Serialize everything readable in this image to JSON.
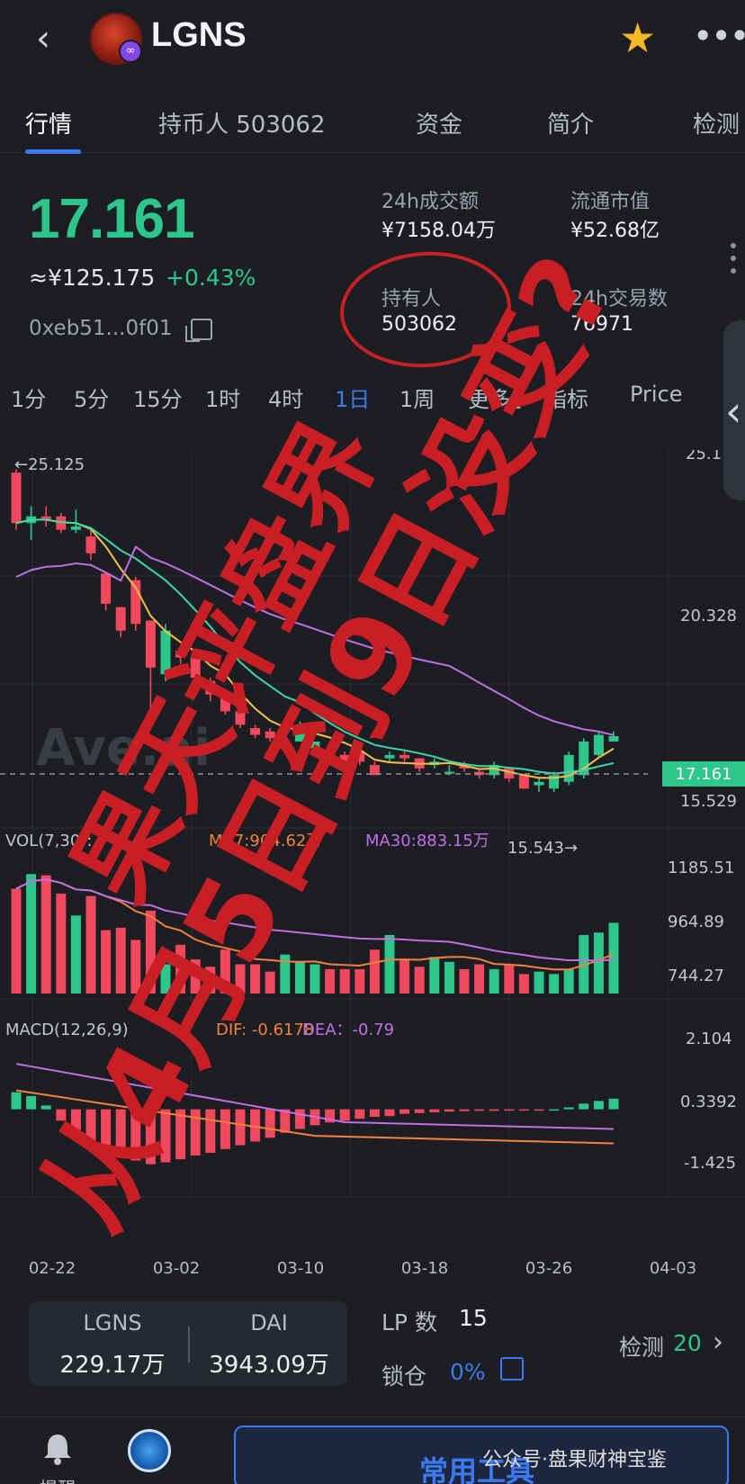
{
  "header": {
    "back_glyph": "‹",
    "title": "LGNS",
    "star_glyph": "★",
    "more_glyph": "•••"
  },
  "tabs": [
    {
      "label": "行情",
      "active": true
    },
    {
      "label": "持币人 503062",
      "active": false
    },
    {
      "label": "资金",
      "active": false
    },
    {
      "label": "简介",
      "active": false
    },
    {
      "label": "检测",
      "active": false
    }
  ],
  "price": {
    "value": "17.161",
    "fiat": "≈¥125.175",
    "change": "+0.43%",
    "address": "0xeb51...0f01"
  },
  "stats": {
    "volume_label": "24h成交额",
    "volume_value": "¥7158.04万",
    "mcap_label": "流通市值",
    "mcap_value": "¥52.68亿",
    "holders_label": "持有人",
    "holders_value": "503062",
    "tx_label": "24h交易数",
    "tx_value": "76971"
  },
  "intervals": [
    "1分",
    "5分",
    "15分",
    "1时",
    "4时",
    "1日",
    "1周",
    "更多",
    "指标",
    "Price"
  ],
  "active_interval": "1日",
  "chart_labels": {
    "high_marker": "←25.125",
    "low_marker": "15.543→",
    "price_tag": "17.161",
    "price_axis": [
      "25.1",
      "20.328",
      "15.529"
    ],
    "vol_title": "VOL(7,30):",
    "vol_ma7": "MA7:904.62万",
    "vol_ma30": "MA30:883.15万",
    "vol_axis": [
      "1185.51",
      "964.89",
      "744.27"
    ],
    "macd_title": "MACD(12,26,9)",
    "macd_dif": "DIF: -0.6178",
    "macd_dea": "DEA：-0.79",
    "macd_axis": [
      "2.104",
      "0.3392",
      "-1.425"
    ],
    "dates": [
      "02-22",
      "03-02",
      "03-10",
      "03-18",
      "03-26",
      "04-03"
    ],
    "watermark": "Ave.ai"
  },
  "chart_data": {
    "type": "candlestick",
    "x": [
      "02-21",
      "02-22",
      "02-23",
      "02-24",
      "02-25",
      "02-26",
      "02-27",
      "02-28",
      "03-01",
      "03-02",
      "03-03",
      "03-04",
      "03-05",
      "03-06",
      "03-07",
      "03-08",
      "03-09",
      "03-10",
      "03-11",
      "03-12",
      "03-13",
      "03-14",
      "03-15",
      "03-16",
      "03-17",
      "03-18",
      "03-19",
      "03-20",
      "03-21",
      "03-22",
      "03-23",
      "03-24",
      "03-25",
      "03-26",
      "03-27",
      "03-28",
      "03-29",
      "03-30",
      "03-31",
      "04-01",
      "04-02"
    ],
    "open": [
      25.0,
      23.5,
      23.7,
      23.7,
      23.3,
      23.1,
      22.0,
      21.0,
      21.8,
      20.6,
      19.0,
      19.7,
      19.5,
      18.8,
      18.3,
      17.9,
      17.4,
      17.3,
      17.3,
      17.0,
      16.8,
      16.7,
      16.6,
      16.7,
      16.3,
      16.5,
      16.6,
      16.5,
      16.3,
      16.1,
      16.3,
      16.1,
      16.0,
      16.2,
      16.0,
      15.7,
      15.6,
      15.8,
      16.0,
      16.6,
      17.0
    ],
    "close": [
      23.5,
      23.7,
      23.6,
      23.3,
      23.4,
      22.6,
      21.1,
      20.3,
      20.5,
      19.2,
      20.3,
      19.5,
      18.9,
      18.4,
      17.9,
      17.5,
      17.2,
      17.1,
      17.4,
      17.5,
      17.0,
      16.6,
      16.3,
      16.4,
      16.0,
      16.6,
      16.5,
      16.2,
      16.4,
      16.1,
      16.2,
      16.0,
      16.3,
      15.9,
      15.6,
      15.8,
      16.0,
      16.6,
      17.0,
      17.2,
      17.16
    ],
    "high": [
      25.1,
      24.0,
      24.0,
      23.8,
      23.9,
      23.3,
      22.0,
      21.0,
      21.9,
      20.6,
      20.5,
      19.8,
      19.5,
      18.9,
      18.4,
      17.9,
      17.5,
      17.4,
      17.6,
      17.6,
      17.0,
      16.8,
      16.7,
      16.7,
      16.4,
      16.7,
      16.7,
      16.5,
      16.5,
      16.3,
      16.4,
      16.2,
      16.4,
      16.2,
      16.0,
      15.9,
      16.1,
      16.7,
      17.1,
      17.3,
      17.3
    ],
    "low": [
      23.3,
      23.0,
      23.4,
      23.2,
      23.2,
      22.4,
      20.9,
      20.1,
      20.3,
      17.8,
      18.8,
      19.3,
      18.8,
      18.2,
      17.8,
      17.4,
      17.1,
      17.0,
      17.1,
      17.0,
      16.7,
      16.5,
      16.2,
      16.3,
      16.0,
      16.4,
      16.4,
      16.1,
      16.2,
      16.0,
      16.1,
      15.9,
      15.9,
      15.8,
      15.6,
      15.5,
      15.5,
      15.7,
      15.9,
      16.5,
      17.0
    ],
    "volume": [
      1130,
      1190,
      1185,
      1110,
      1020,
      1100,
      960,
      970,
      920,
      1040,
      820,
      900,
      840,
      810,
      880,
      820,
      820,
      790,
      860,
      830,
      820,
      800,
      800,
      800,
      880,
      940,
      840,
      810,
      850,
      830,
      800,
      820,
      800,
      820,
      780,
      790,
      780,
      800,
      940,
      950,
      990
    ],
    "macd_hist": [
      0.45,
      0.35,
      0.1,
      -0.3,
      -0.55,
      -0.85,
      -1.05,
      -1.2,
      -1.35,
      -1.45,
      -1.4,
      -1.32,
      -1.22,
      -1.15,
      -1.05,
      -0.95,
      -0.85,
      -0.75,
      -0.62,
      -0.52,
      -0.42,
      -0.35,
      -0.3,
      -0.25,
      -0.2,
      -0.18,
      -0.12,
      -0.1,
      -0.08,
      -0.06,
      -0.05,
      -0.04,
      -0.04,
      -0.03,
      -0.02,
      -0.02,
      0.0,
      0.05,
      0.15,
      0.22,
      0.28
    ],
    "ylim_price": [
      15.5,
      25.3
    ],
    "ylim_volume": [
      700,
      1250
    ],
    "ylim_macd": [
      -1.6,
      2.2
    ],
    "colors": {
      "up": "#2ec78b",
      "down": "#f0485c",
      "ma_yellow": "#f2c14a",
      "ma_green": "#3fd8a4",
      "ma_purple": "#c26ee8",
      "ma_orange": "#f2823a"
    }
  },
  "bottom": {
    "pair_left_name": "LGNS",
    "pair_left_amount": "229.17万",
    "pair_right_name": "DAI",
    "pair_right_amount": "3943.09万",
    "lp_label": "LP 数",
    "lp_value": "15",
    "lock_label": "锁仓",
    "lock_value": "0%",
    "detect_label": "检测",
    "detect_count": "20",
    "chevron": "›"
  },
  "nav": {
    "bell_label": "提醒",
    "tools_label": "常用工具",
    "wechat_watermark": "公众号·盘果财神宝鉴"
  },
  "overlay_text": {
    "line1": "果天评盘界",
    "line2": "从4月5日到9日没变?"
  }
}
